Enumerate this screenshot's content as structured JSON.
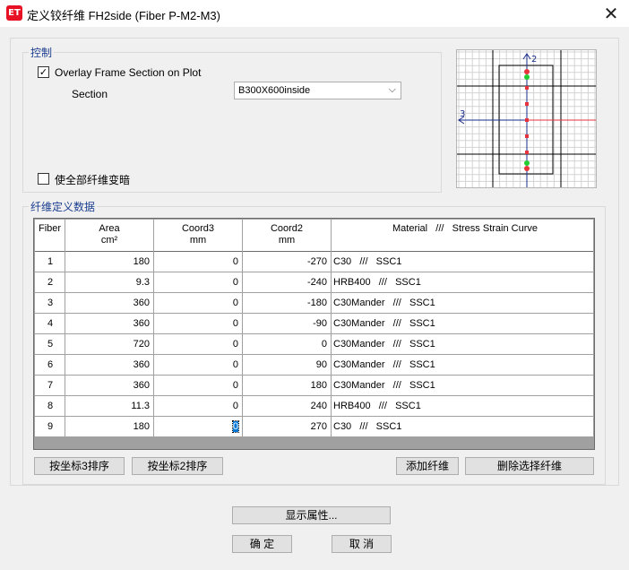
{
  "window": {
    "app_icon": "ET",
    "title": "定义铰纤维 FH2side  (Fiber P-M2-M3)",
    "close_glyph": "✕"
  },
  "control": {
    "caption": "控制",
    "overlay_label": "Overlay Frame Section on Plot",
    "overlay_checked": true,
    "section_label": "Section",
    "section_value": "B300X600inside",
    "dim_label": "使全部纤维变暗",
    "dim_checked": false
  },
  "preview": {
    "axis2_label": "2",
    "axis3_label": "3",
    "colors": {
      "grid": "#d3d3d3",
      "frame": "#000000",
      "axis2": "#1a2e8a",
      "axis3_left": "#1a2e8a",
      "axis3_right": "#e8323c",
      "fiber_red": "#e8323c",
      "fiber_green": "#22cc33"
    }
  },
  "fibers": {
    "caption": "纤维定义数据",
    "columns": {
      "fiber": "Fiber",
      "area": "Area",
      "area_unit": "cm²",
      "coord3": "Coord3",
      "coord3_unit": "mm",
      "coord2": "Coord2",
      "coord2_unit": "mm",
      "material": "Material   ///   Stress Strain Curve"
    },
    "rows": [
      {
        "id": "1",
        "area": "180",
        "coord3": "0",
        "coord2": "-270",
        "material": "C30   ///   SSC1"
      },
      {
        "id": "2",
        "area": "9.3",
        "coord3": "0",
        "coord2": "-240",
        "material": "HRB400   ///   SSC1"
      },
      {
        "id": "3",
        "area": "360",
        "coord3": "0",
        "coord2": "-180",
        "material": "C30Mander   ///   SSC1"
      },
      {
        "id": "4",
        "area": "360",
        "coord3": "0",
        "coord2": "-90",
        "material": "C30Mander   ///   SSC1"
      },
      {
        "id": "5",
        "area": "720",
        "coord3": "0",
        "coord2": "0",
        "material": "C30Mander   ///   SSC1"
      },
      {
        "id": "6",
        "area": "360",
        "coord3": "0",
        "coord2": "90",
        "material": "C30Mander   ///   SSC1"
      },
      {
        "id": "7",
        "area": "360",
        "coord3": "0",
        "coord2": "180",
        "material": "C30Mander   ///   SSC1"
      },
      {
        "id": "8",
        "area": "11.3",
        "coord3": "0",
        "coord2": "240",
        "material": "HRB400   ///   SSC1"
      },
      {
        "id": "9",
        "area": "180",
        "coord3": "0",
        "coord2": "270",
        "material": "C30   ///   SSC1"
      }
    ],
    "buttons": {
      "sort3": "按坐标3排序",
      "sort2": "按坐标2排序",
      "add": "添加纤维",
      "delete": "删除选择纤维"
    }
  },
  "footer": {
    "show_props": "显示属性...",
    "ok": "确 定",
    "cancel": "取 消"
  }
}
